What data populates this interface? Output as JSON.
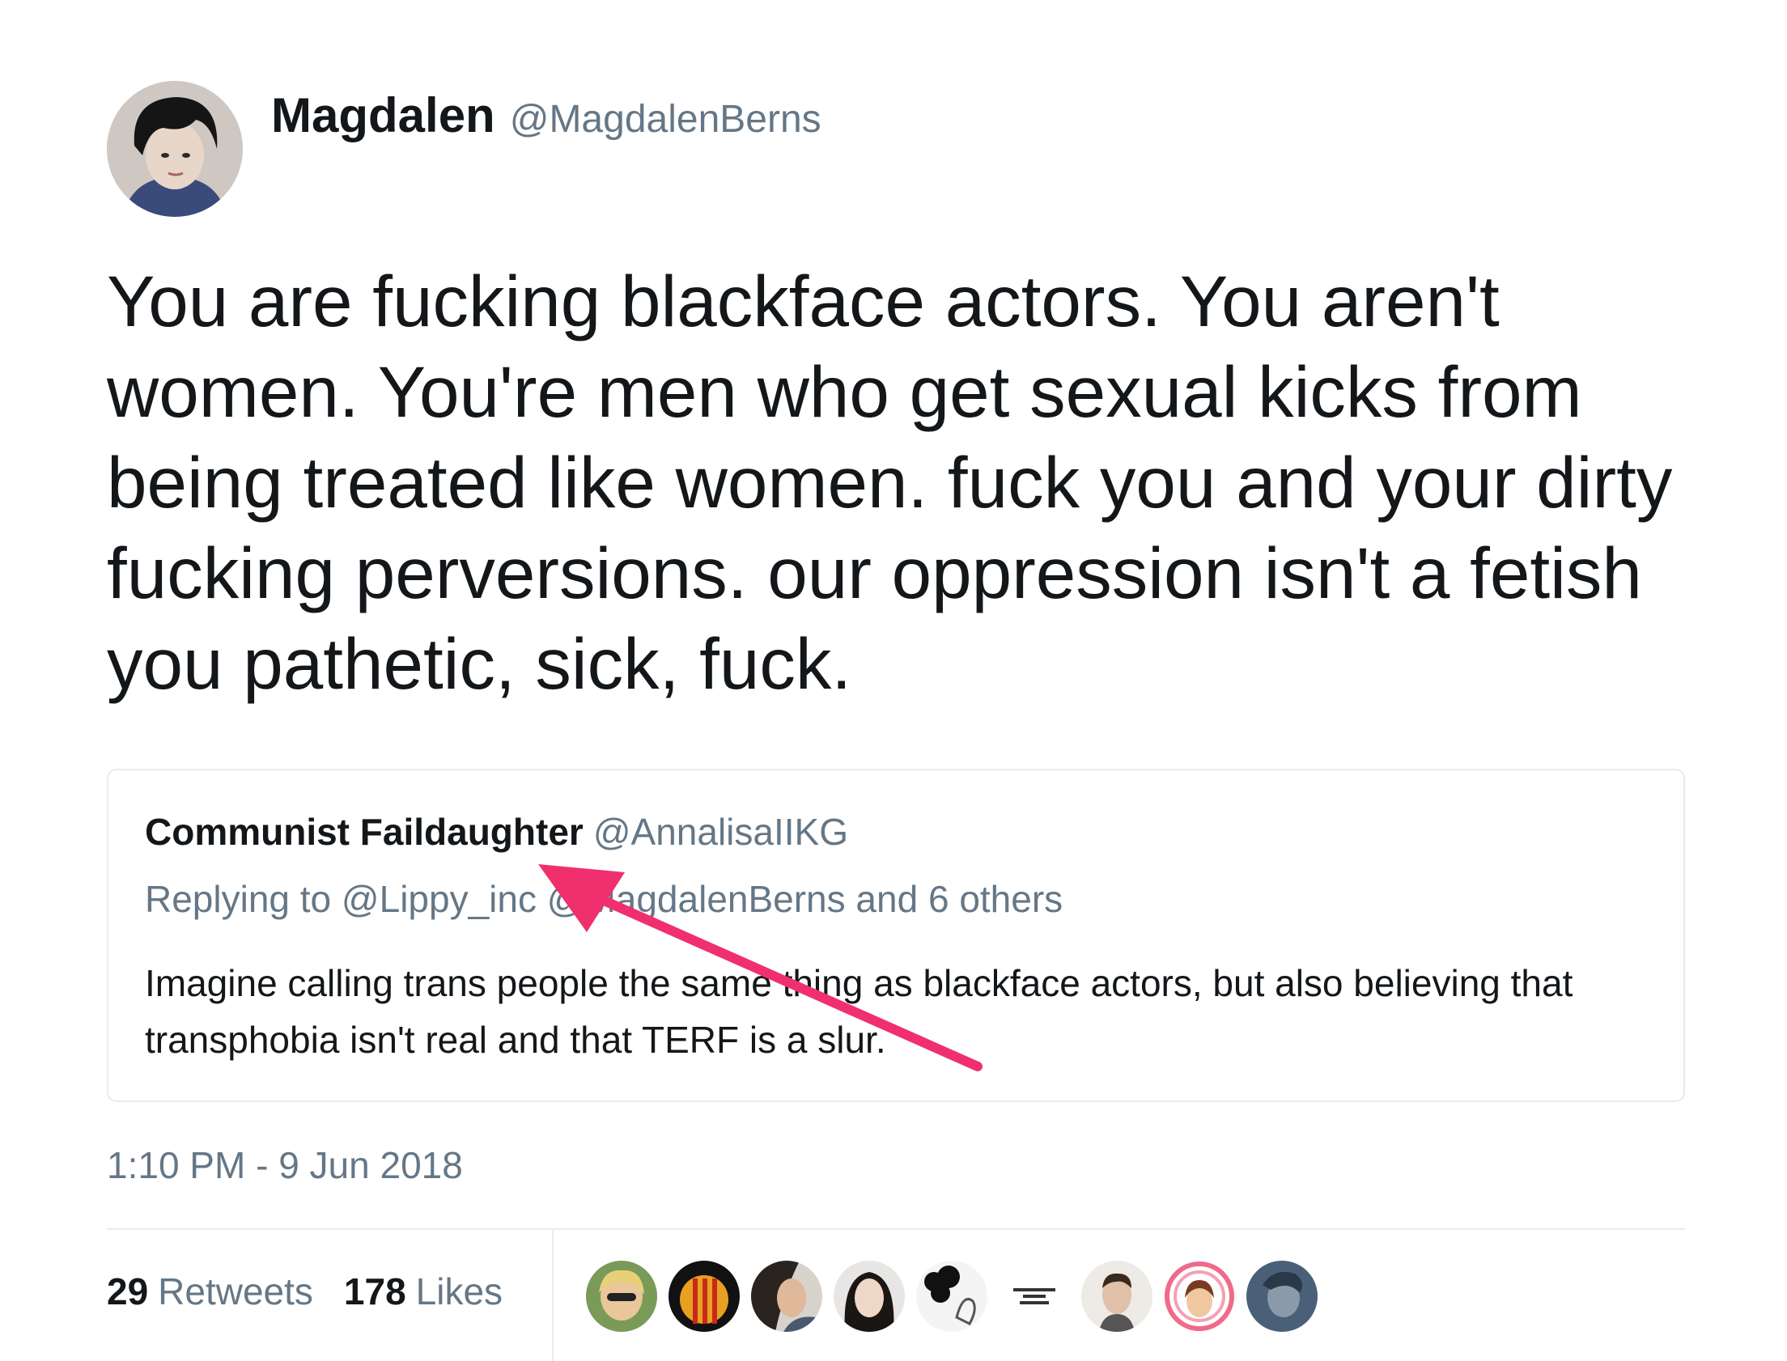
{
  "tweet": {
    "author_name": "Magdalen",
    "author_handle": "@MagdalenBerns",
    "text": "You are fucking blackface actors. You aren't women. You're men who get sexual kicks from being treated like women. fuck you and your dirty fucking perversions. our oppression isn't a fetish you pathetic, sick, fuck.",
    "timestamp": "1:10 PM - 9 Jun 2018",
    "avatar_icon": "user-avatar-photo"
  },
  "quoted_tweet": {
    "author_name": "Communist Faildaughter",
    "author_handle": "@AnnalisaIIKG",
    "replying_to": "Replying to @Lippy_inc @MagdalenBerns and 6 others",
    "text": "Imagine calling trans people the same thing as blackface actors, but also believing that transphobia isn't real and that TERF is a slur."
  },
  "stats": {
    "retweets_count": "29",
    "retweets_label": "Retweets",
    "likes_count": "178",
    "likes_label": "Likes"
  },
  "likers": [
    {
      "icon": "liker-avatar-1"
    },
    {
      "icon": "liker-avatar-2"
    },
    {
      "icon": "liker-avatar-3"
    },
    {
      "icon": "liker-avatar-4"
    },
    {
      "icon": "liker-avatar-5"
    },
    {
      "icon": "liker-avatar-6"
    },
    {
      "icon": "liker-avatar-7"
    },
    {
      "icon": "liker-avatar-8"
    },
    {
      "icon": "liker-avatar-9"
    }
  ],
  "colors": {
    "primary_text": "#14171a",
    "secondary_text": "#657786",
    "border": "#e6ecf0",
    "annotation_arrow": "#f0306e"
  }
}
